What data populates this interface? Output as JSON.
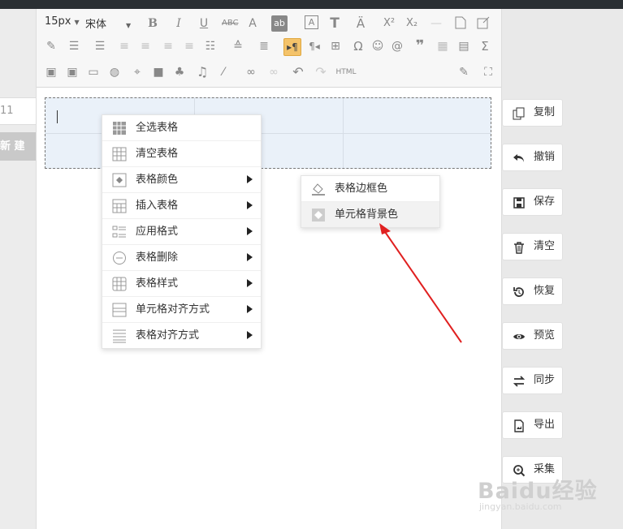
{
  "left": {
    "input_value": "11",
    "new_button": "新 建"
  },
  "toolbar": {
    "font_size": "15px",
    "font_family": "宋体",
    "html_label": "HTML"
  },
  "context_menu": {
    "items": [
      {
        "label": "全选表格",
        "icon": "select-all-table-icon",
        "submenu": false
      },
      {
        "label": "清空表格",
        "icon": "clear-table-icon",
        "submenu": false
      },
      {
        "label": "表格颜色",
        "icon": "table-color-icon",
        "submenu": true
      },
      {
        "label": "插入表格",
        "icon": "insert-table-icon",
        "submenu": true
      },
      {
        "label": "应用格式",
        "icon": "apply-format-icon",
        "submenu": true
      },
      {
        "label": "表格删除",
        "icon": "delete-table-icon",
        "submenu": true
      },
      {
        "label": "表格样式",
        "icon": "table-style-icon",
        "submenu": true
      },
      {
        "label": "单元格对齐方式",
        "icon": "cell-align-icon",
        "submenu": true
      },
      {
        "label": "表格对齐方式",
        "icon": "table-align-icon",
        "submenu": true
      }
    ]
  },
  "submenu": {
    "items": [
      {
        "label": "表格边框色",
        "icon": "border-color-icon"
      },
      {
        "label": "单元格背景色",
        "icon": "cell-background-icon",
        "highlighted": true
      }
    ]
  },
  "right_buttons": [
    {
      "label": "复制",
      "icon": "copy-icon"
    },
    {
      "label": "撤销",
      "icon": "undo-icon"
    },
    {
      "label": "保存",
      "icon": "save-icon"
    },
    {
      "label": "清空",
      "icon": "trash-icon"
    },
    {
      "label": "恢复",
      "icon": "restore-icon"
    },
    {
      "label": "预览",
      "icon": "eye-icon"
    },
    {
      "label": "同步",
      "icon": "sync-icon"
    },
    {
      "label": "导出",
      "icon": "export-icon"
    },
    {
      "label": "采集",
      "icon": "collect-icon"
    }
  ],
  "watermark": {
    "brand": "Baidu经验",
    "url": "jingyan.baidu.com"
  },
  "colors": {
    "highlight": "#f4c36a",
    "arrow": "#e02020",
    "table_bg": "#eaf1f9"
  }
}
